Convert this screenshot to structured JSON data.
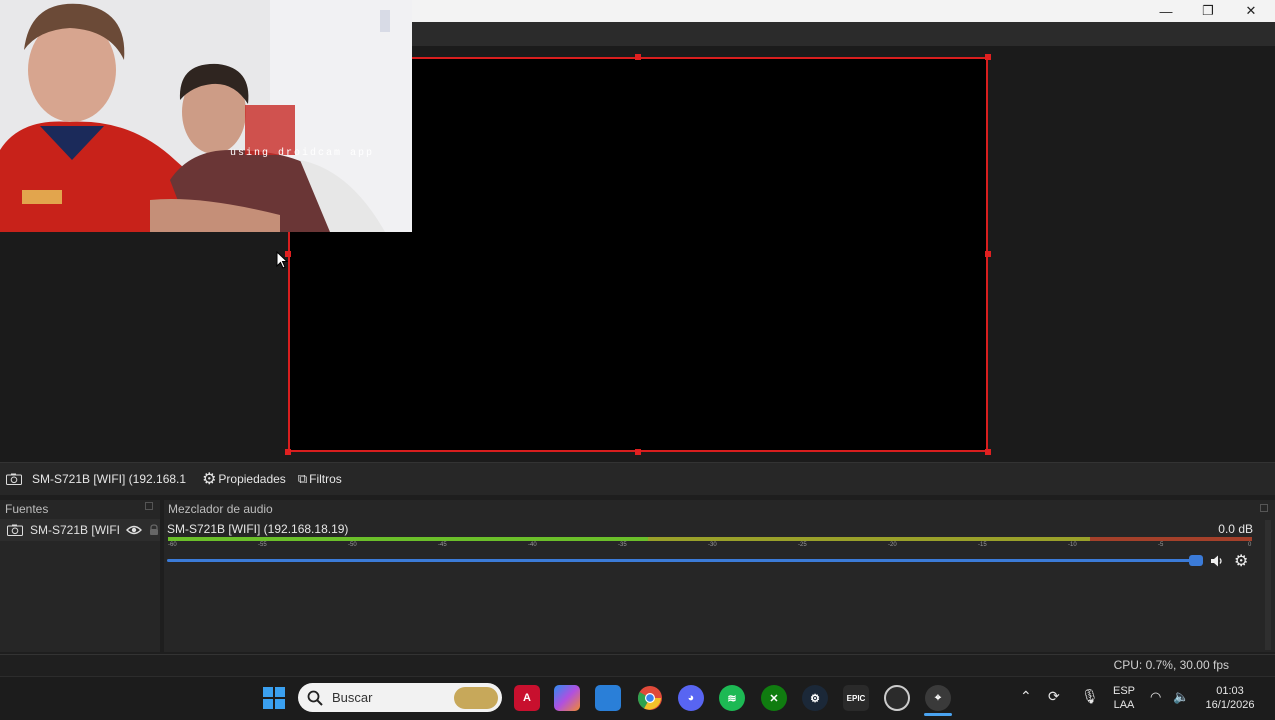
{
  "window": {
    "minimize_glyph": "—",
    "maximize_glyph": "❐",
    "close_glyph": "✕"
  },
  "webcam": {
    "overlay_text": "using droidcam app"
  },
  "source_toolbar": {
    "source_name": "SM-S721B [WIFI] (192.168.1",
    "properties_label": "Propiedades",
    "filters_label": "Filtros"
  },
  "sources_dock": {
    "title": "Fuentes",
    "items": [
      {
        "label": "SM-S721B [WIFI",
        "icon": "camera-icon"
      }
    ]
  },
  "mixer_dock": {
    "title": "Mezclador de audio",
    "channel": {
      "name": "SM-S721B [WIFI] (192.168.18.19)",
      "db": "0.0 dB",
      "volume_fraction": 1.0,
      "ticks": [
        "-60",
        "-55",
        "-50",
        "-45",
        "-40",
        "-35",
        "-30",
        "-25",
        "-20",
        "-15",
        "-10",
        "-5",
        "0"
      ]
    },
    "colors": {
      "green": "#6bbf2a",
      "yellow": "#b8a82a",
      "red": "#b33a2a",
      "slider": "#3b7bd8"
    }
  },
  "status": {
    "cpu": "CPU: 0.7%, 30.00 fps"
  },
  "taskbar": {
    "search_placeholder": "Buscar",
    "apps": [
      "windows-start-icon",
      "amd-icon",
      "copilot-icon",
      "photos-icon",
      "chrome-icon",
      "discord-icon",
      "spotify-icon",
      "xbox-icon",
      "steam-icon",
      "epic-games-icon",
      "obs-icon",
      "maps-icon"
    ],
    "epic_label": "EPIC",
    "tray": {
      "lang_top": "ESP",
      "lang_bottom": "LAA",
      "time": "01:03",
      "date": "16/1/2026"
    }
  }
}
